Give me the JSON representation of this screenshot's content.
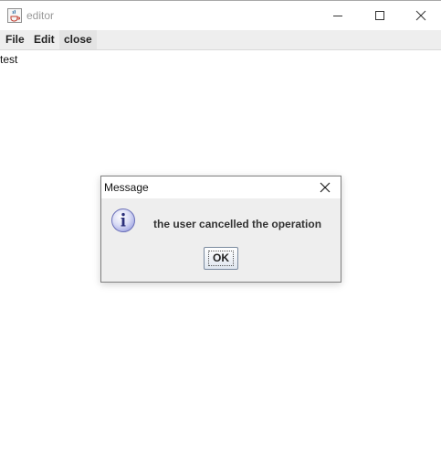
{
  "window": {
    "title": "editor",
    "icon": "java-cup-icon"
  },
  "menu": {
    "items": [
      {
        "label": "File"
      },
      {
        "label": "Edit"
      },
      {
        "label": "close"
      }
    ]
  },
  "editor": {
    "content": "test"
  },
  "dialog": {
    "title": "Message",
    "message": "the user cancelled the operation",
    "icon": "information-icon",
    "ok_label": "OK"
  }
}
